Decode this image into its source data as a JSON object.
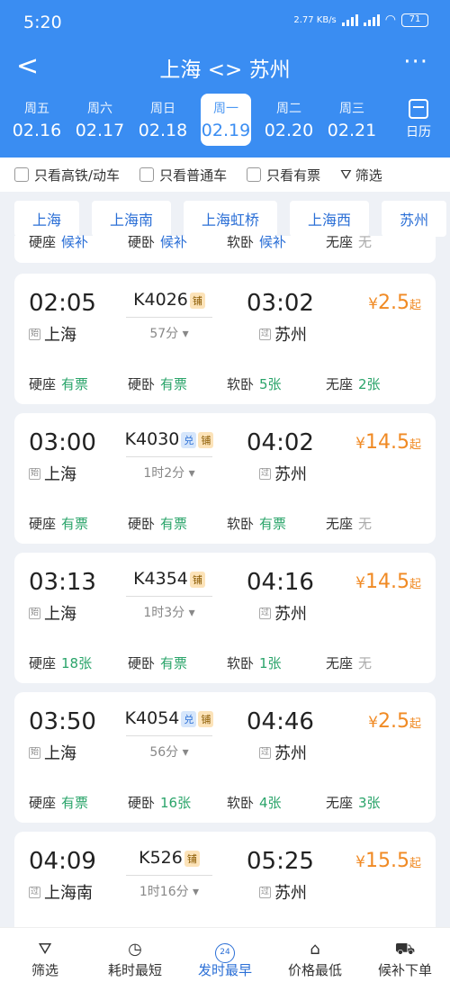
{
  "status": {
    "time": "5:20",
    "net_speed": "2.77 KB/s",
    "battery": "71"
  },
  "nav": {
    "back": "<",
    "title": "上海 <> 苏州",
    "more": "···"
  },
  "dates": [
    {
      "weekday": "周五",
      "date": "02.16"
    },
    {
      "weekday": "周六",
      "date": "02.17"
    },
    {
      "weekday": "周日",
      "date": "02.18"
    },
    {
      "weekday": "周一",
      "date": "02.19",
      "active": true
    },
    {
      "weekday": "周二",
      "date": "02.20"
    },
    {
      "weekday": "周三",
      "date": "02.21"
    }
  ],
  "calendar_label": "日历",
  "filters": {
    "hs": "只看高铁/动车",
    "normal": "只看普通车",
    "available": "只看有票",
    "filter": "筛选"
  },
  "stations": [
    "上海",
    "上海南",
    "上海虹桥",
    "上海西",
    "苏州"
  ],
  "partial_row": [
    {
      "label": "硬座",
      "value": "候补"
    },
    {
      "label": "硬卧",
      "value": "候补"
    },
    {
      "label": "软卧",
      "value": "候补"
    },
    {
      "label": "无座",
      "value": "无"
    }
  ],
  "trains": [
    {
      "dep": "02:05",
      "arr": "03:02",
      "no": "K4026",
      "badges": [
        "铺"
      ],
      "duration": "57分",
      "from_tag": "始",
      "from": "上海",
      "to_tag": "过",
      "to": "苏州",
      "price_sym": "¥",
      "price": "2.5",
      "price_suffix": "起",
      "seats": [
        {
          "label": "硬座",
          "value": "有票"
        },
        {
          "label": "硬卧",
          "value": "有票"
        },
        {
          "label": "软卧",
          "value": "5张"
        },
        {
          "label": "无座",
          "value": "2张"
        }
      ]
    },
    {
      "dep": "03:00",
      "arr": "04:02",
      "no": "K4030",
      "badges": [
        "兑",
        "铺"
      ],
      "duration": "1时2分",
      "from_tag": "始",
      "from": "上海",
      "to_tag": "过",
      "to": "苏州",
      "price_sym": "¥",
      "price": "14.5",
      "price_suffix": "起",
      "seats": [
        {
          "label": "硬座",
          "value": "有票"
        },
        {
          "label": "硬卧",
          "value": "有票"
        },
        {
          "label": "软卧",
          "value": "有票"
        },
        {
          "label": "无座",
          "value": "无"
        }
      ]
    },
    {
      "dep": "03:13",
      "arr": "04:16",
      "no": "K4354",
      "badges": [
        "铺"
      ],
      "duration": "1时3分",
      "from_tag": "始",
      "from": "上海",
      "to_tag": "过",
      "to": "苏州",
      "price_sym": "¥",
      "price": "14.5",
      "price_suffix": "起",
      "seats": [
        {
          "label": "硬座",
          "value": "18张"
        },
        {
          "label": "硬卧",
          "value": "有票"
        },
        {
          "label": "软卧",
          "value": "1张"
        },
        {
          "label": "无座",
          "value": "无"
        }
      ]
    },
    {
      "dep": "03:50",
      "arr": "04:46",
      "no": "K4054",
      "badges": [
        "兑",
        "铺"
      ],
      "duration": "56分",
      "from_tag": "始",
      "from": "上海",
      "to_tag": "过",
      "to": "苏州",
      "price_sym": "¥",
      "price": "2.5",
      "price_suffix": "起",
      "seats": [
        {
          "label": "硬座",
          "value": "有票"
        },
        {
          "label": "硬卧",
          "value": "16张"
        },
        {
          "label": "软卧",
          "value": "4张"
        },
        {
          "label": "无座",
          "value": "3张"
        }
      ]
    },
    {
      "dep": "04:09",
      "arr": "05:25",
      "no": "K526",
      "badges": [
        "铺"
      ],
      "duration": "1时16分",
      "from_tag": "过",
      "from": "上海南",
      "to_tag": "过",
      "to": "苏州",
      "price_sym": "¥",
      "price": "15.5",
      "price_suffix": "起",
      "seats": []
    }
  ],
  "bottom": [
    {
      "label": "筛选",
      "icon": "filter-icon",
      "glyph": "⛛"
    },
    {
      "label": "耗时最短",
      "icon": "clock-icon",
      "glyph": "◷"
    },
    {
      "label": "发时最早",
      "icon": "24h-icon",
      "glyph": "24",
      "active": true
    },
    {
      "label": "价格最低",
      "icon": "tag-icon",
      "glyph": "⌂"
    },
    {
      "label": "候补下单",
      "icon": "cart-icon",
      "glyph": "⛟"
    }
  ],
  "colors": {
    "accent": "#3a8df2",
    "price": "#f08a24",
    "available": "#2aa46a"
  }
}
